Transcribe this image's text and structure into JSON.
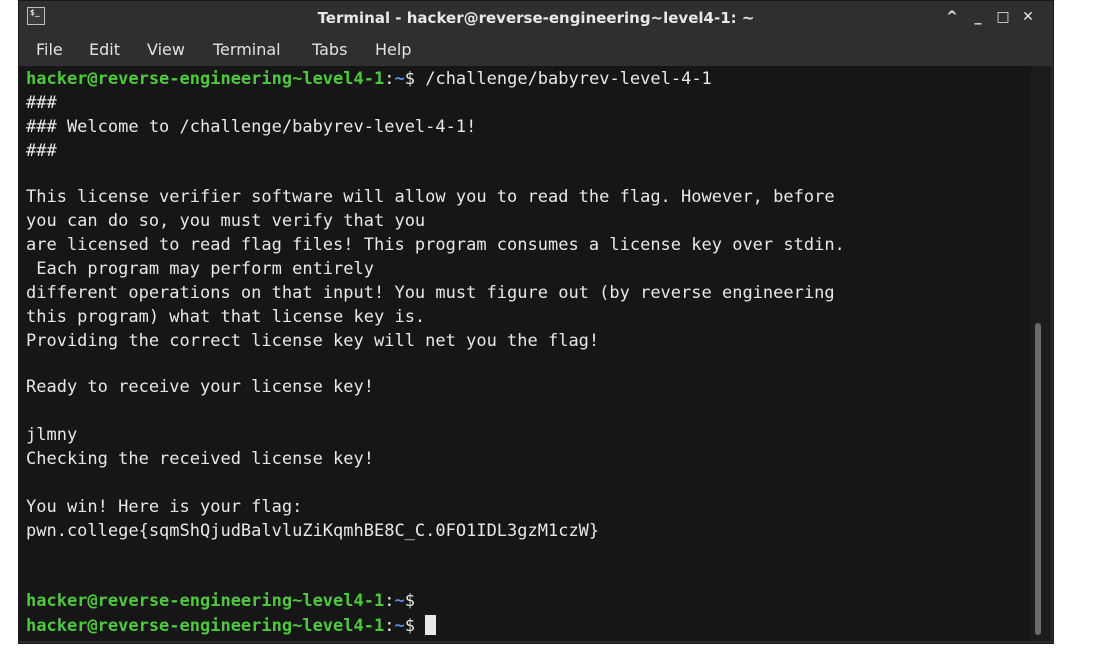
{
  "window": {
    "title": "Terminal - hacker@reverse-engineering~level4-1: ~",
    "app_icon_glyph": "$_",
    "controls": {
      "up": "^",
      "minimize": "_",
      "maximize": "□",
      "close": "✕"
    }
  },
  "menu": [
    "File",
    "Edit",
    "View",
    "Terminal",
    "Tabs",
    "Help"
  ],
  "terminal": {
    "prompt_user": "hacker@reverse-engineering~level4-1",
    "prompt_sep": ":",
    "prompt_path": "~",
    "prompt_dollar": "$ ",
    "command": "/challenge/babyrev-level-4-1",
    "output_lines": [
      "###",
      "### Welcome to /challenge/babyrev-level-4-1!",
      "###",
      "",
      "This license verifier software will allow you to read the flag. However, before",
      "you can do so, you must verify that you",
      "are licensed to read flag files! This program consumes a license key over stdin.",
      " Each program may perform entirely",
      "different operations on that input! You must figure out (by reverse engineering",
      "this program) what that license key is.",
      "Providing the correct license key will net you the flag!",
      "",
      "Ready to receive your license key!",
      "",
      "jlmny",
      "Checking the received license key!",
      "",
      "You win! Here is your flag:",
      "pwn.college{sqmShQjudBalvluZiKqmhBE8C_C.0FO1IDL3gzM1czW}",
      "",
      ""
    ]
  },
  "colors": {
    "background": "#161616",
    "prompt_user": "#4ec93e",
    "prompt_path": "#5c8ddb",
    "text": "#e8e8e8"
  }
}
